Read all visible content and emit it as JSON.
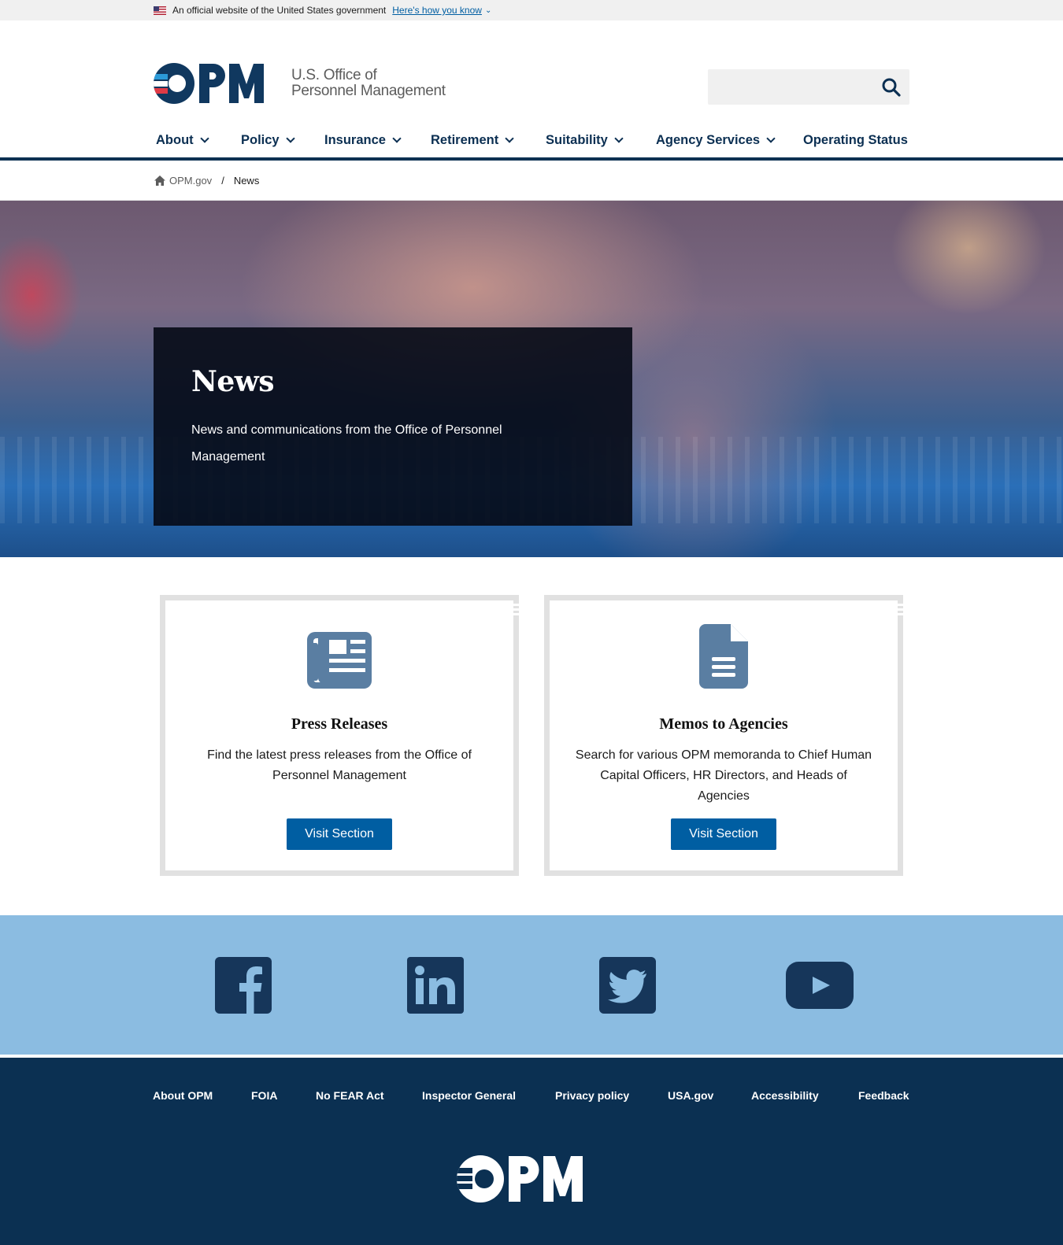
{
  "gov_banner": {
    "official_text": "An official website of the United States government",
    "how_link": "Here's how you know"
  },
  "logo": {
    "wordmark": "OPM",
    "line1": "U.S. Office of",
    "line2": "Personnel Management"
  },
  "nav": {
    "items": [
      {
        "label": "About",
        "has_dropdown": true
      },
      {
        "label": "Policy",
        "has_dropdown": true
      },
      {
        "label": "Insurance",
        "has_dropdown": true
      },
      {
        "label": "Retirement",
        "has_dropdown": true
      },
      {
        "label": "Suitability",
        "has_dropdown": true
      },
      {
        "label": "Agency Services",
        "has_dropdown": true
      },
      {
        "label": "Operating Status",
        "has_dropdown": false
      }
    ]
  },
  "breadcrumb": {
    "home": "OPM.gov",
    "separator": "/",
    "current": "News"
  },
  "hero": {
    "title": "News",
    "description": "News and communications from the Office of Personnel Management"
  },
  "cards": [
    {
      "icon": "newspaper-icon",
      "title": "Press Releases",
      "description": "Find the latest press releases from the Office of Personnel Management",
      "button": "Visit Section"
    },
    {
      "icon": "document-icon",
      "title": "Memos to Agencies",
      "description": "Search for various OPM memoranda to Chief Human Capital Officers, HR Directors, and Heads of Agencies",
      "button": "Visit Section"
    }
  ],
  "social": [
    "facebook-icon",
    "linkedin-icon",
    "twitter-icon",
    "youtube-icon"
  ],
  "footer": {
    "links": [
      "About OPM",
      "FOIA",
      "No FEAR Act",
      "Inspector General",
      "Privacy policy",
      "USA.gov",
      "Accessibility",
      "Feedback"
    ],
    "wordmark": "OPM"
  },
  "colors": {
    "navy": "#0b3052",
    "button_blue": "#005ea2",
    "social_band": "#8bbce1",
    "icon_slate": "#5a7ea2",
    "logo_red": "#e03a45",
    "logo_blue": "#2b9ad8"
  }
}
